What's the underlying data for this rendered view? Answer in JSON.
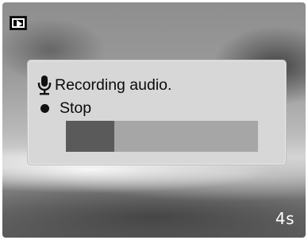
{
  "playback_icon": "playback-mode-icon",
  "dialog": {
    "status_label": "Recording audio.",
    "status_icon": "microphone-icon",
    "stop_label": "Stop",
    "stop_icon": "record-dot-icon"
  },
  "progress": {
    "fraction": 0.25
  },
  "timer": {
    "text": "4s"
  },
  "colors": {
    "dialog_bg": "#d7d7d7",
    "progress_track": "#a6a6a6",
    "progress_fill": "#5a5a5a"
  }
}
